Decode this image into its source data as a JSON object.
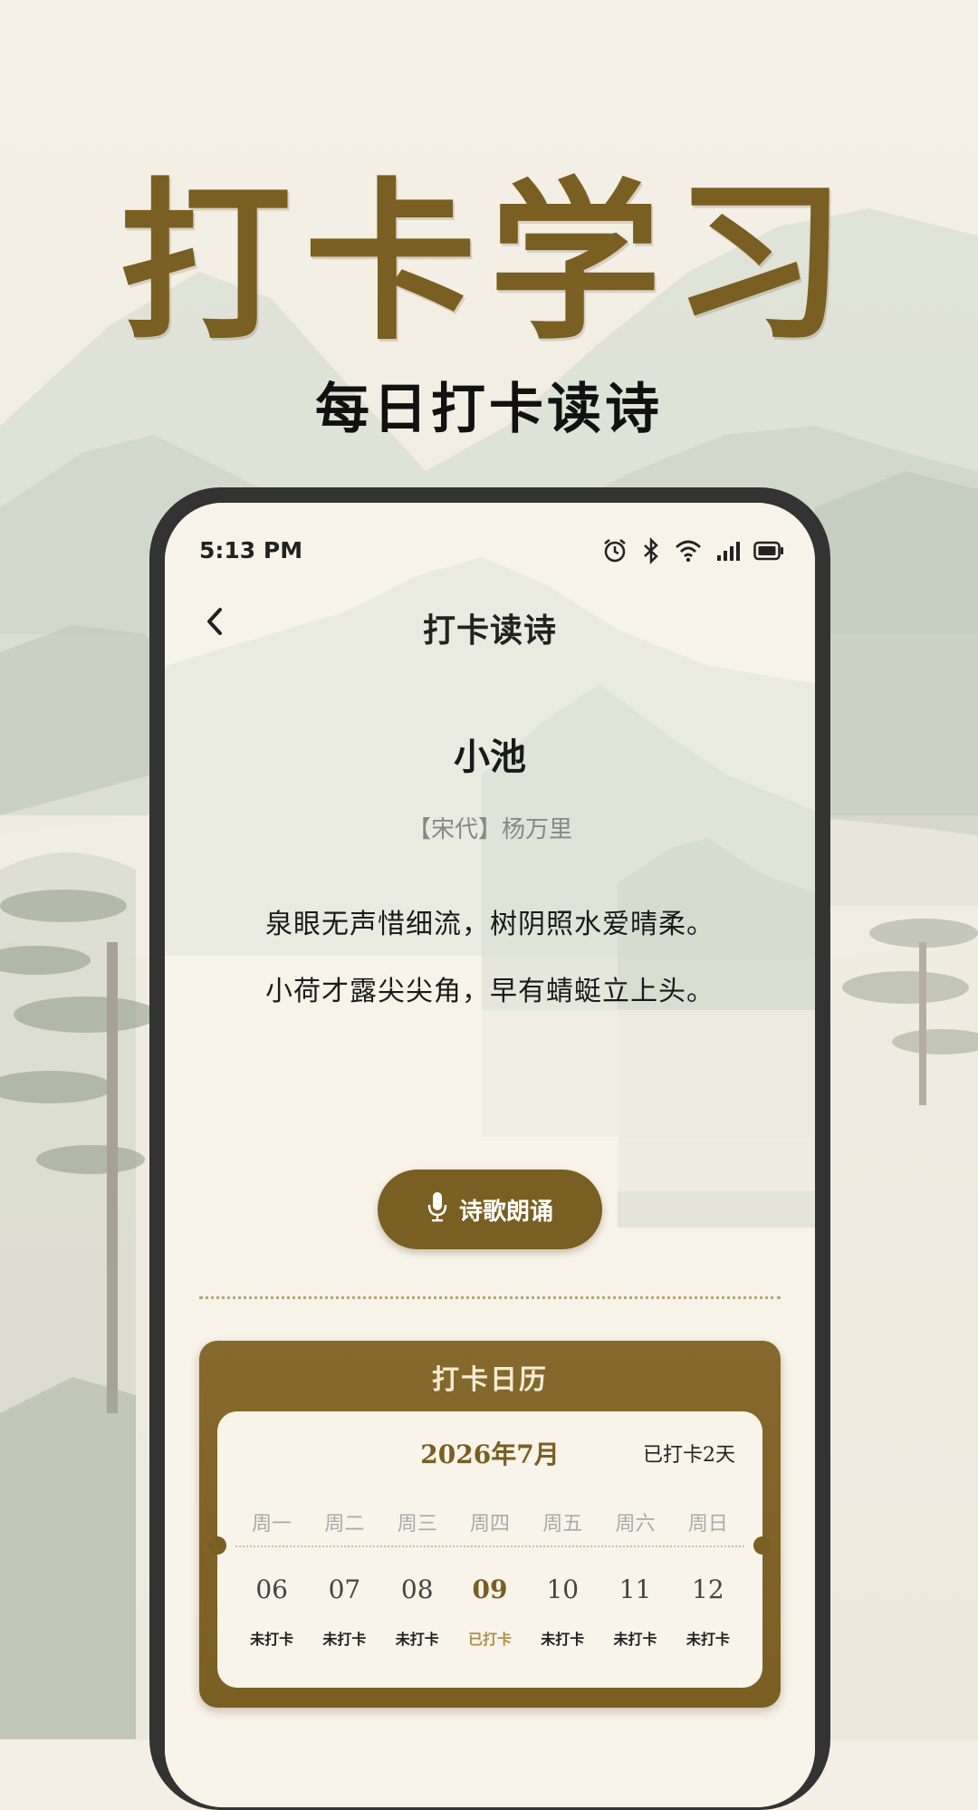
{
  "hero": {
    "title": "打卡学习",
    "subtitle": "每日打卡读诗"
  },
  "status_bar": {
    "time": "5:13 PM",
    "icons": [
      "alarm-icon",
      "bluetooth-icon",
      "wifi-icon",
      "signal-icon",
      "battery-icon"
    ]
  },
  "nav": {
    "back_icon": "chevron-left-icon",
    "title": "打卡读诗"
  },
  "poem": {
    "title": "小池",
    "author": "【宋代】杨万里",
    "lines": [
      "泉眼无声惜细流，树阴照水爱晴柔。",
      "小荷才露尖尖角，早有蜻蜓立上头。"
    ]
  },
  "recite_button": {
    "icon": "microphone-icon",
    "label": "诗歌朗诵"
  },
  "calendar": {
    "header": "打卡日历",
    "month": "2026年7月",
    "checked_count": "已打卡2天",
    "weekdays": [
      "周一",
      "周二",
      "周三",
      "周四",
      "周五",
      "周六",
      "周日"
    ],
    "days": [
      {
        "date": "06",
        "status": "未打卡"
      },
      {
        "date": "07",
        "status": "未打卡"
      },
      {
        "date": "08",
        "status": "未打卡"
      },
      {
        "date": "09",
        "status": "已打卡"
      },
      {
        "date": "10",
        "status": "未打卡"
      },
      {
        "date": "11",
        "status": "未打卡"
      },
      {
        "date": "12",
        "status": "未打卡"
      }
    ],
    "today_index": 3
  },
  "colors": {
    "accent": "#7a5f22",
    "background": "#f3efe4",
    "phone_frame": "#333333"
  }
}
